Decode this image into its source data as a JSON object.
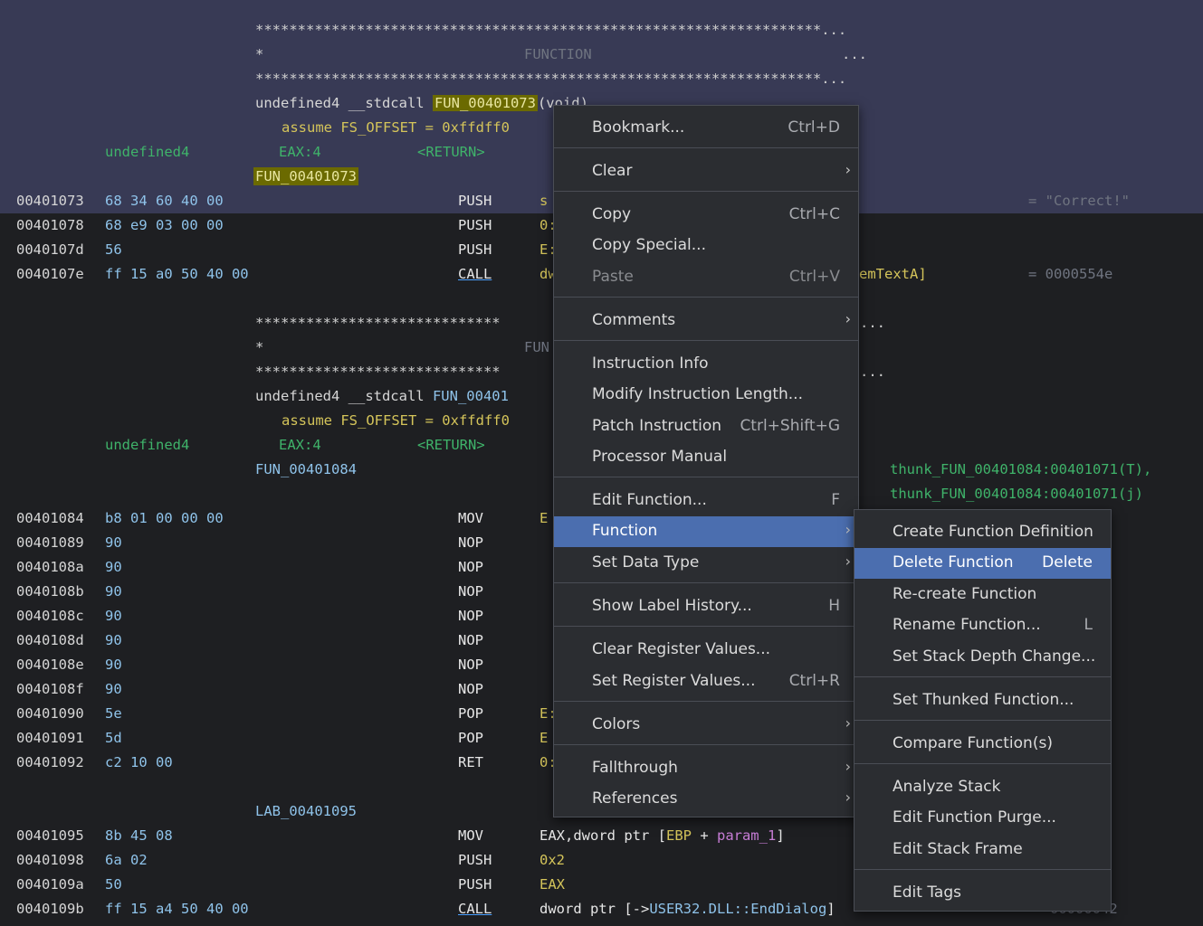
{
  "listing": {
    "stars_long": "*******************************************************************...",
    "stars_short": "*****************************",
    "star": "*",
    "function_header": "FUNCTION",
    "function_header_clipped": "FUN",
    "ellipsis": "...",
    "func1": {
      "signature_prefix": "undefined4 __stdcall ",
      "name": "FUN_00401073",
      "signature_suffix": "(void)",
      "assume": "assume FS_OFFSET = 0xffdff0",
      "ret_type": "undefined4",
      "ret_reg": "EAX:4",
      "ret_tag": "<RETURN>",
      "label": "FUN_00401073"
    },
    "rows1": [
      {
        "addr": "00401073",
        "bytes": "68 34 60 40 00",
        "mn": "PUSH",
        "op": "s",
        "comment": "= \"Correct!\""
      },
      {
        "addr": "00401078",
        "bytes": "68 e9 03 00 00",
        "mn": "PUSH",
        "op": "0:"
      },
      {
        "addr": "0040107d",
        "bytes": "56",
        "mn": "PUSH",
        "op": "E:"
      },
      {
        "addr": "0040107e",
        "bytes": "ff 15 a0 50 40 00",
        "mn": "CALL",
        "op": "dw",
        "op_tail": "emTextA]",
        "comment": "= 0000554e"
      }
    ],
    "func2": {
      "signature_prefix": "undefined4 __stdcall ",
      "name": "FUN_00401",
      "assume": "assume FS_OFFSET = 0xffdff0",
      "ret_type": "undefined4",
      "ret_reg": "EAX:4",
      "ret_tag": "<RETURN>",
      "label": "FUN_00401084",
      "xref1": "thunk_FUN_00401084:00401071(T),",
      "xref2": "thunk_FUN_00401084:00401071(j)"
    },
    "rows2": [
      {
        "addr": "00401084",
        "bytes": "b8 01 00 00 00",
        "mn": "MOV",
        "op": "E"
      },
      {
        "addr": "00401089",
        "bytes": "90",
        "mn": "NOP",
        "op": ""
      },
      {
        "addr": "0040108a",
        "bytes": "90",
        "mn": "NOP",
        "op": ""
      },
      {
        "addr": "0040108b",
        "bytes": "90",
        "mn": "NOP",
        "op": ""
      },
      {
        "addr": "0040108c",
        "bytes": "90",
        "mn": "NOP",
        "op": ""
      },
      {
        "addr": "0040108d",
        "bytes": "90",
        "mn": "NOP",
        "op": ""
      },
      {
        "addr": "0040108e",
        "bytes": "90",
        "mn": "NOP",
        "op": ""
      },
      {
        "addr": "0040108f",
        "bytes": "90",
        "mn": "NOP",
        "op": ""
      },
      {
        "addr": "00401090",
        "bytes": "5e",
        "mn": "POP",
        "op": "E:"
      },
      {
        "addr": "00401091",
        "bytes": "5d",
        "mn": "POP",
        "op": "E"
      },
      {
        "addr": "00401092",
        "bytes": "c2 10 00",
        "mn": "RET",
        "op": "0:"
      }
    ],
    "lab": "LAB_00401095",
    "rows3": [
      {
        "addr": "00401095",
        "bytes": "8b 45 08",
        "mn": "MOV"
      },
      {
        "addr": "00401098",
        "bytes": "6a 02",
        "mn": "PUSH",
        "op": "0x2"
      },
      {
        "addr": "0040109a",
        "bytes": "50",
        "mn": "PUSH",
        "op": "EAX"
      },
      {
        "addr": "0040109b",
        "bytes": "ff 15 a4 50 40 00",
        "mn": "CALL"
      }
    ],
    "mov_op": {
      "a": "EAX,dword ptr [",
      "b": "EBP",
      "c": " + ",
      "d": "param_1",
      "e": "]"
    },
    "call_op": {
      "a": "dword ptr [->",
      "b": "USER32.DLL::EndDialog",
      "c": "]"
    },
    "tail_comment": "00000042"
  },
  "context_menu": {
    "items": [
      {
        "label": "Bookmark...",
        "shortcut": "Ctrl+D"
      },
      {
        "label": "Clear"
      },
      {
        "label": "Copy",
        "shortcut": "Ctrl+C"
      },
      {
        "label": "Copy Special..."
      },
      {
        "label": "Paste",
        "shortcut": "Ctrl+V"
      },
      {
        "label": "Comments"
      },
      {
        "label": "Instruction Info"
      },
      {
        "label": "Modify Instruction Length..."
      },
      {
        "label": "Patch Instruction",
        "shortcut": "Ctrl+Shift+G"
      },
      {
        "label": "Processor Manual"
      },
      {
        "label": "Edit Function...",
        "shortcut": "F"
      },
      {
        "label": "Function"
      },
      {
        "label": "Set Data Type"
      },
      {
        "label": "Show Label History...",
        "shortcut": "H"
      },
      {
        "label": "Clear Register Values..."
      },
      {
        "label": "Set Register Values...",
        "shortcut": "Ctrl+R"
      },
      {
        "label": "Colors"
      },
      {
        "label": "Fallthrough"
      },
      {
        "label": "References"
      }
    ]
  },
  "function_submenu": {
    "items": [
      {
        "label": "Create Function Definition"
      },
      {
        "label": "Delete Function",
        "shortcut": "Delete"
      },
      {
        "label": "Re-create Function"
      },
      {
        "label": "Rename Function...",
        "shortcut": "L"
      },
      {
        "label": "Set Stack Depth Change..."
      },
      {
        "label": "Set Thunked Function..."
      },
      {
        "label": "Compare Function(s)"
      },
      {
        "label": "Analyze Stack"
      },
      {
        "label": "Edit Function Purge..."
      },
      {
        "label": "Edit Stack Frame"
      },
      {
        "label": "Edit Tags"
      }
    ]
  },
  "colors": {
    "highlight_band": "#383a55",
    "menu_active": "#4b6eaf",
    "name_highlight": "#6b6a00"
  }
}
